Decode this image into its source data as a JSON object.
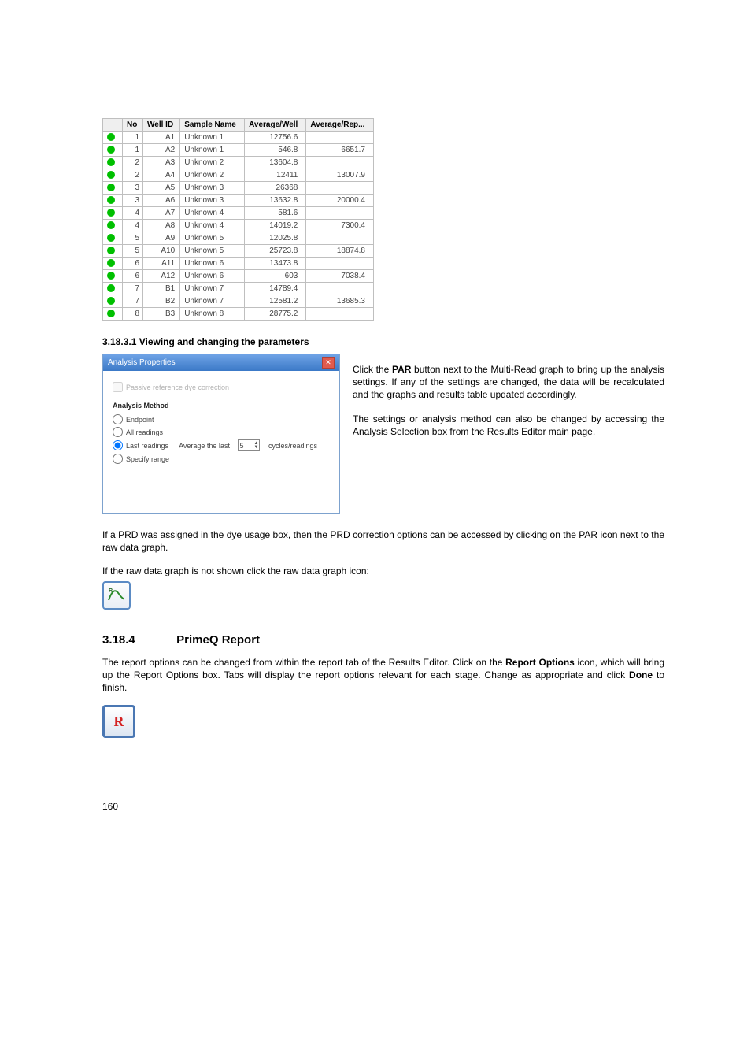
{
  "table": {
    "headers": [
      "",
      "No",
      "Well ID",
      "Sample Name",
      "Average/Well",
      "Average/Rep..."
    ],
    "rows": [
      {
        "no": "1",
        "well": "A1",
        "name": "Unknown 1",
        "avg": "12756.6",
        "rep": ""
      },
      {
        "no": "1",
        "well": "A2",
        "name": "Unknown 1",
        "avg": "546.8",
        "rep": "6651.7"
      },
      {
        "no": "2",
        "well": "A3",
        "name": "Unknown 2",
        "avg": "13604.8",
        "rep": ""
      },
      {
        "no": "2",
        "well": "A4",
        "name": "Unknown 2",
        "avg": "12411",
        "rep": "13007.9"
      },
      {
        "no": "3",
        "well": "A5",
        "name": "Unknown 3",
        "avg": "26368",
        "rep": ""
      },
      {
        "no": "3",
        "well": "A6",
        "name": "Unknown 3",
        "avg": "13632.8",
        "rep": "20000.4"
      },
      {
        "no": "4",
        "well": "A7",
        "name": "Unknown 4",
        "avg": "581.6",
        "rep": ""
      },
      {
        "no": "4",
        "well": "A8",
        "name": "Unknown 4",
        "avg": "14019.2",
        "rep": "7300.4"
      },
      {
        "no": "5",
        "well": "A9",
        "name": "Unknown 5",
        "avg": "12025.8",
        "rep": ""
      },
      {
        "no": "5",
        "well": "A10",
        "name": "Unknown 5",
        "avg": "25723.8",
        "rep": "18874.8"
      },
      {
        "no": "6",
        "well": "A11",
        "name": "Unknown 6",
        "avg": "13473.8",
        "rep": ""
      },
      {
        "no": "6",
        "well": "A12",
        "name": "Unknown 6",
        "avg": "603",
        "rep": "7038.4"
      },
      {
        "no": "7",
        "well": "B1",
        "name": "Unknown 7",
        "avg": "14789.4",
        "rep": ""
      },
      {
        "no": "7",
        "well": "B2",
        "name": "Unknown 7",
        "avg": "12581.2",
        "rep": "13685.3"
      },
      {
        "no": "8",
        "well": "B3",
        "name": "Unknown 8",
        "avg": "28775.2",
        "rep": ""
      }
    ]
  },
  "heading1": "3.18.3.1   Viewing and changing the parameters",
  "dialog": {
    "title": "Analysis Properties",
    "prd_checkbox": "Passive reference dye correction",
    "method_label": "Analysis Method",
    "opt_endpoint": "Endpoint",
    "opt_all": "All readings",
    "opt_last_prefix": "Last readings",
    "opt_last_text1": "Average the last",
    "opt_last_value": "5",
    "opt_last_text2": "cycles/readings",
    "opt_specify": "Specify range"
  },
  "rightcol": {
    "p1a": "Click the ",
    "p1b": "PAR",
    "p1c": " button next to the Multi-Read graph to bring up the analysis settings. If any of the settings are changed, the data will be recalculated and the graphs and results table updated accordingly.",
    "p2": "The settings or analysis method can also be changed by accessing the Analysis Selection box from the Results Editor main page."
  },
  "prd_para": "If a PRD was assigned in the dye usage box, then the PRD correction options can be accessed by clicking on the PAR icon next to the raw data graph.",
  "rawdata_para": "If the raw data graph is not shown click the raw data graph icon:",
  "section2_num": "3.18.4",
  "section2_title": "PrimeQ Report",
  "report_para_a": "The report options can be changed from within the report tab of the Results Editor. Click on the ",
  "report_para_b": "Report Options",
  "report_para_c": " icon, which will bring up the Report Options box. Tabs will display the report options relevant for each stage. Change as appropriate and click ",
  "report_para_d": "Done",
  "report_para_e": " to finish.",
  "icon_r_letter": "R",
  "graph_icon_letter": "R",
  "pagenum": "160"
}
